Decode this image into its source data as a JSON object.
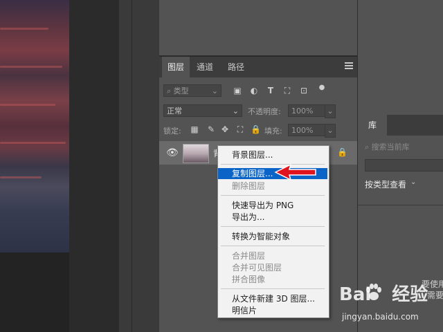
{
  "layers_panel": {
    "tabs": [
      {
        "label": "图层",
        "active": true
      },
      {
        "label": "通道",
        "active": false
      },
      {
        "label": "路径",
        "active": false
      }
    ],
    "filter_kind": "类型",
    "blend_mode": "正常",
    "opacity_label": "不透明度:",
    "opacity_value": "100%",
    "lock_label": "锁定:",
    "fill_label": "填充:",
    "fill_value": "100%",
    "layer_name_visible": "背"
  },
  "context_menu": {
    "items": [
      {
        "label": "背景图层...",
        "enabled": true
      },
      {
        "label": "复制图层...",
        "enabled": true,
        "highlighted": true
      },
      {
        "label": "删除图层",
        "enabled": false
      },
      {
        "label": "快速导出为 PNG",
        "enabled": true
      },
      {
        "label": "导出为...",
        "enabled": true
      },
      {
        "label": "转换为智能对象",
        "enabled": true
      },
      {
        "label": "合并图层",
        "enabled": false
      },
      {
        "label": "合并可见图层",
        "enabled": false
      },
      {
        "label": "拼合图像",
        "enabled": false
      },
      {
        "label": "从文件新建 3D 图层...",
        "enabled": true
      },
      {
        "label": "明信片",
        "enabled": true
      }
    ]
  },
  "library_panel": {
    "tab": "库",
    "search_placeholder": "搜索当前库",
    "sort_label": "按类型查看",
    "hint_line1": "要使用",
    "hint_line2": "需要"
  },
  "watermark": {
    "logo_text_a": "Bai",
    "logo_text_b": "经验",
    "url": "jingyan.baidu.com"
  },
  "colors": {
    "panel": "#535353",
    "tabbar": "#3c3c3c",
    "highlight": "#0a64c8",
    "arrow": "#e0141e"
  },
  "icons": {
    "filter": "search-icon",
    "image_filter": "image-icon",
    "adjust_filter": "circle-half-icon",
    "text_filter": "text-icon",
    "shape_filter": "crop-icon",
    "smart_filter": "dot-icon",
    "visibility": "eye-icon",
    "lock": "lock-icon"
  }
}
